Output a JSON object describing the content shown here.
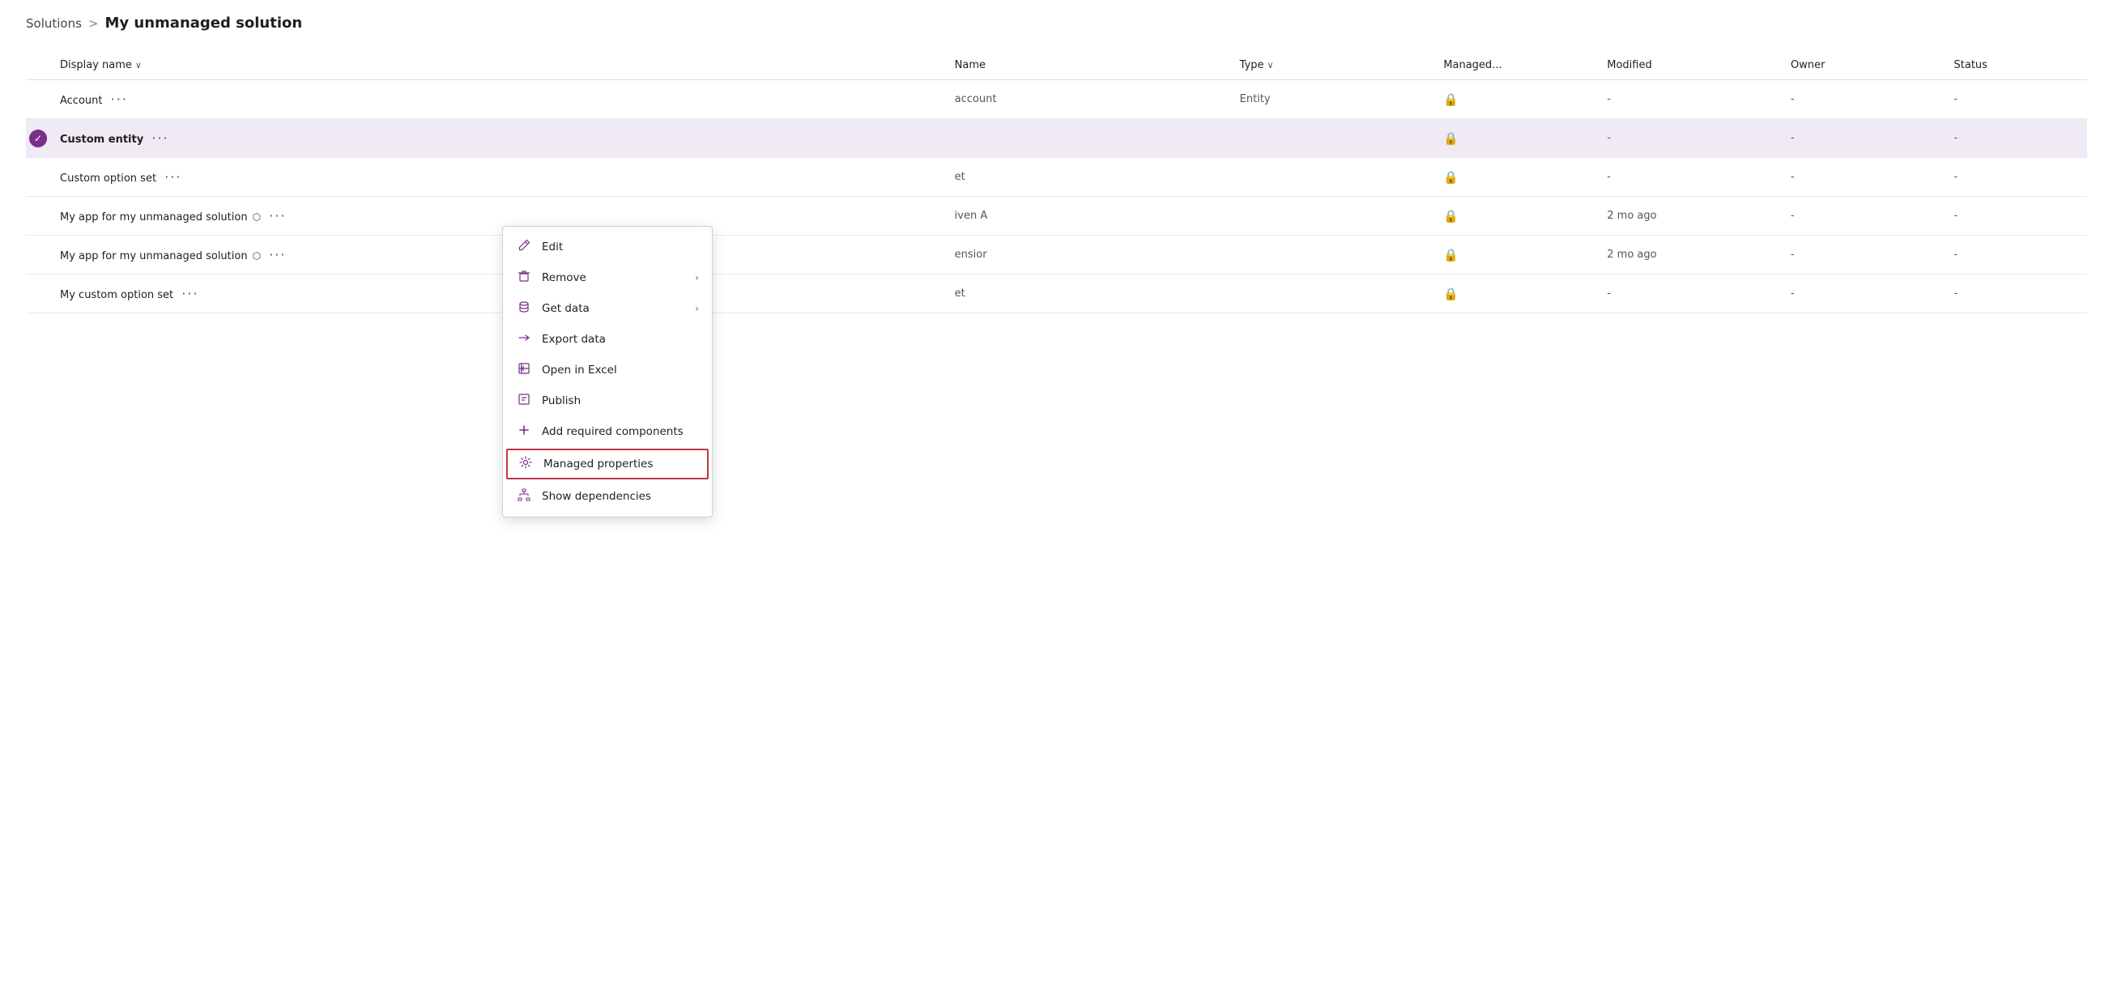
{
  "breadcrumb": {
    "solutions_label": "Solutions",
    "separator": ">",
    "current": "My unmanaged solution"
  },
  "table": {
    "columns": [
      {
        "id": "display-name",
        "label": "Display name",
        "has_sort": true
      },
      {
        "id": "name",
        "label": "Name",
        "has_sort": false
      },
      {
        "id": "type",
        "label": "Type",
        "has_sort": true
      },
      {
        "id": "managed",
        "label": "Managed...",
        "has_sort": false
      },
      {
        "id": "modified",
        "label": "Modified",
        "has_sort": false
      },
      {
        "id": "owner",
        "label": "Owner",
        "has_sort": false
      },
      {
        "id": "status",
        "label": "Status",
        "has_sort": false
      }
    ],
    "rows": [
      {
        "id": "row-account",
        "selected": false,
        "display_name": "Account",
        "has_ext_link": false,
        "name": "account",
        "type": "Entity",
        "managed": "lock",
        "modified": "-",
        "owner": "-",
        "status": "-"
      },
      {
        "id": "row-custom-entity",
        "selected": true,
        "display_name": "Custom entity",
        "has_ext_link": false,
        "name": "",
        "type": "",
        "managed": "lock",
        "modified": "-",
        "owner": "-",
        "status": "-"
      },
      {
        "id": "row-custom-option-set",
        "selected": false,
        "display_name": "Custom option set",
        "has_ext_link": false,
        "name": "et",
        "type": "",
        "managed": "lock",
        "modified": "-",
        "owner": "-",
        "status": "-"
      },
      {
        "id": "row-app1",
        "selected": false,
        "display_name": "My app for my unmanaged solution",
        "has_ext_link": true,
        "name": "iven A",
        "type": "",
        "managed": "lock",
        "modified": "2 mo ago",
        "owner": "-",
        "status": "-"
      },
      {
        "id": "row-app2",
        "selected": false,
        "display_name": "My app for my unmanaged solution",
        "has_ext_link": true,
        "name": "ensior",
        "type": "",
        "managed": "lock",
        "modified": "2 mo ago",
        "owner": "-",
        "status": "-"
      },
      {
        "id": "row-my-custom-option-set",
        "selected": false,
        "display_name": "My custom option set",
        "has_ext_link": false,
        "name": "et",
        "type": "",
        "managed": "lock",
        "modified": "-",
        "owner": "-",
        "status": "-"
      }
    ]
  },
  "context_menu": {
    "items": [
      {
        "id": "edit",
        "label": "Edit",
        "icon": "pencil",
        "has_submenu": false,
        "highlighted": false
      },
      {
        "id": "remove",
        "label": "Remove",
        "icon": "trash",
        "has_submenu": true,
        "highlighted": false
      },
      {
        "id": "get-data",
        "label": "Get data",
        "icon": "database",
        "has_submenu": true,
        "highlighted": false
      },
      {
        "id": "export-data",
        "label": "Export data",
        "icon": "export",
        "has_submenu": false,
        "highlighted": false
      },
      {
        "id": "open-excel",
        "label": "Open in Excel",
        "icon": "excel",
        "has_submenu": false,
        "highlighted": false
      },
      {
        "id": "publish",
        "label": "Publish",
        "icon": "publish",
        "has_submenu": false,
        "highlighted": false
      },
      {
        "id": "add-required",
        "label": "Add required components",
        "icon": "plus",
        "has_submenu": false,
        "highlighted": false
      },
      {
        "id": "managed-properties",
        "label": "Managed properties",
        "icon": "gear",
        "has_submenu": false,
        "highlighted": true
      },
      {
        "id": "show-dependencies",
        "label": "Show dependencies",
        "icon": "dependencies",
        "has_submenu": false,
        "highlighted": false
      }
    ]
  },
  "icons": {
    "pencil": "✏",
    "trash": "🗑",
    "database": "🗄",
    "export": "→",
    "excel": "⊞",
    "publish": "⊟",
    "plus": "+",
    "gear": "⚙",
    "dependencies": "⊕",
    "lock": "🔒",
    "ext_link": "⬡",
    "check": "✓",
    "chevron_down": "∨",
    "chevron_right": "›"
  }
}
